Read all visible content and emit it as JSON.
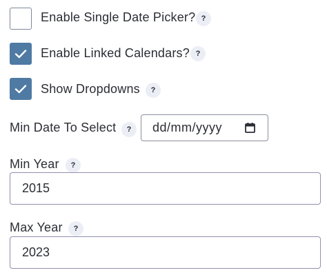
{
  "options": {
    "single_date_picker": {
      "label": "Enable Single Date Picker?",
      "checked": false,
      "help": "?"
    },
    "linked_calendars": {
      "label": "Enable Linked Calendars?",
      "checked": true,
      "help": "?"
    },
    "show_dropdowns": {
      "label": "Show Dropdowns",
      "checked": true,
      "help": "?"
    }
  },
  "min_date": {
    "label": "Min Date To Select",
    "help": "?",
    "value": "dd/mm/yyyy",
    "icon": "calendar-icon"
  },
  "min_year": {
    "label": "Min Year",
    "help": "?",
    "value": "2015"
  },
  "max_year": {
    "label": "Max Year",
    "help": "?",
    "value": "2023"
  },
  "colors": {
    "accent": "#4f7aa3",
    "help_bg": "#eceef6",
    "text": "#2b2d35"
  }
}
